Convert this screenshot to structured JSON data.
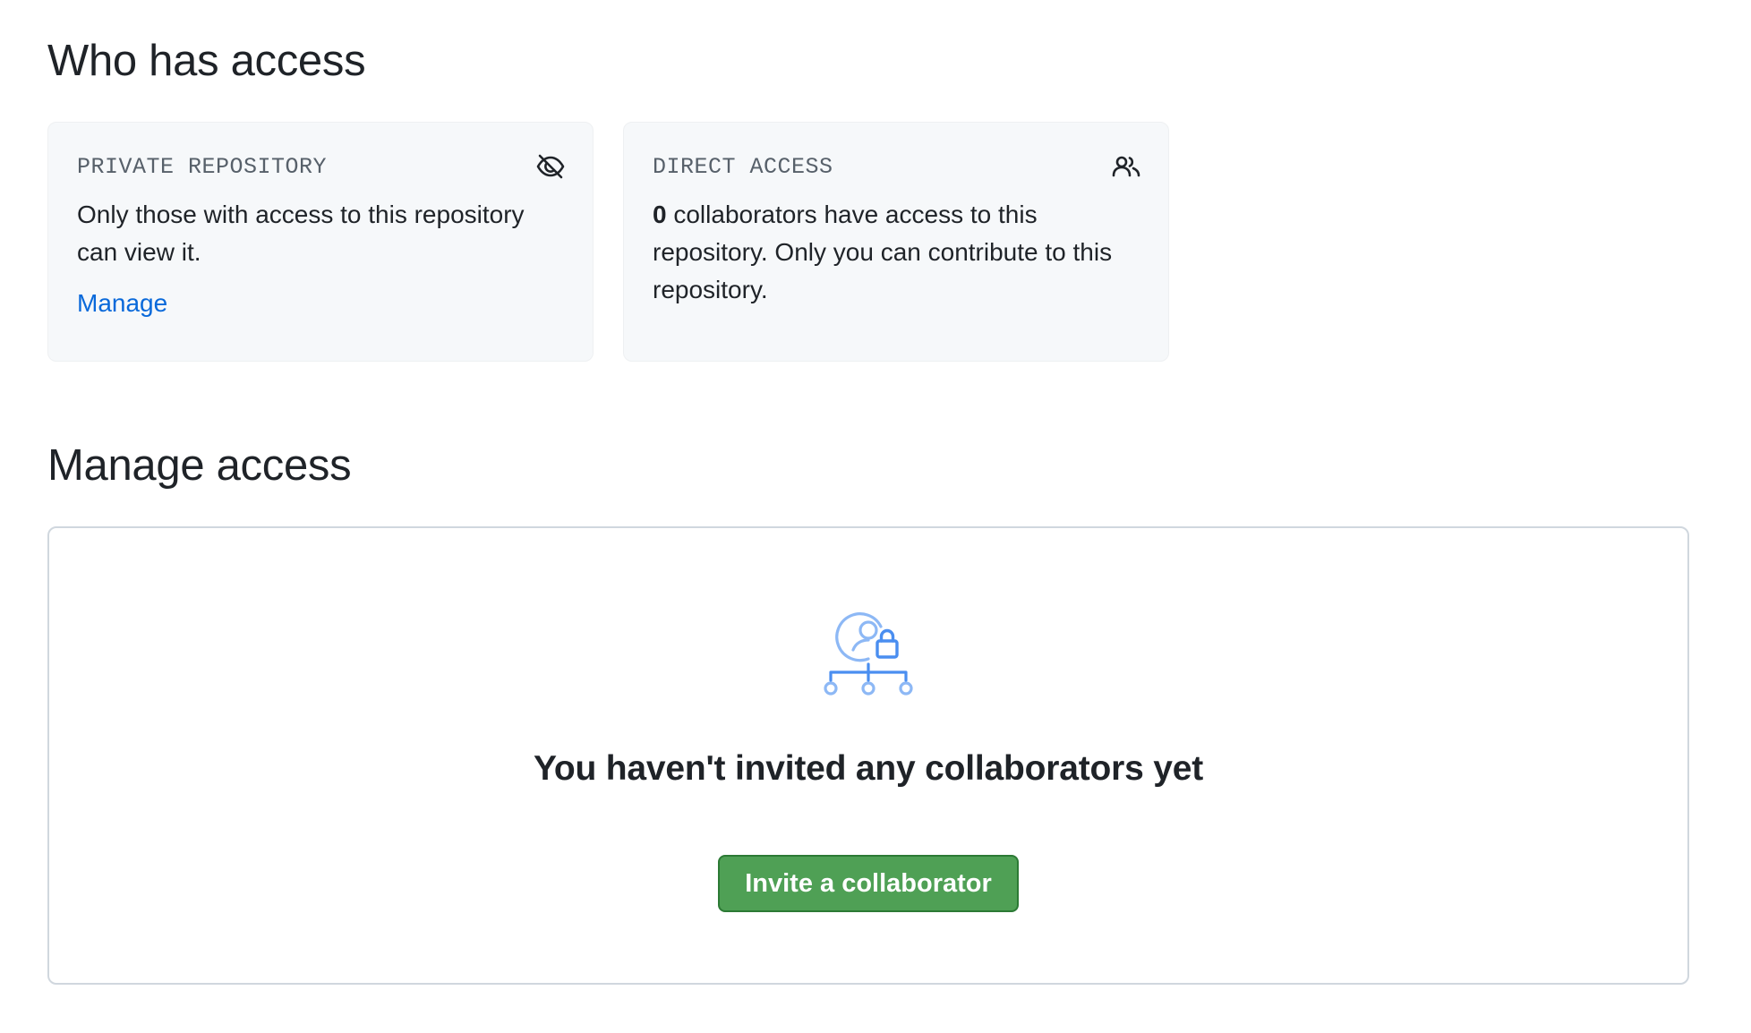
{
  "who_has_access": {
    "title": "Who has access",
    "private_card": {
      "label": "PRIVATE REPOSITORY",
      "icon": "eye-closed-icon",
      "text": "Only those with access to this repository can view it.",
      "link": "Manage"
    },
    "direct_card": {
      "label": "DIRECT ACCESS",
      "icon": "people-icon",
      "count": "0",
      "text": " collaborators have access to this repository. Only you can contribute to this repository."
    }
  },
  "manage_access": {
    "title": "Manage access",
    "empty_icon": "person-lock-network-icon",
    "empty_title": "You haven't invited any collaborators yet",
    "invite_button": "Invite a collaborator"
  },
  "colors": {
    "link": "#0969da",
    "button_green": "#4fa055",
    "card_bg": "#f6f8fa",
    "illustration_blue": "#4a8ef0"
  }
}
